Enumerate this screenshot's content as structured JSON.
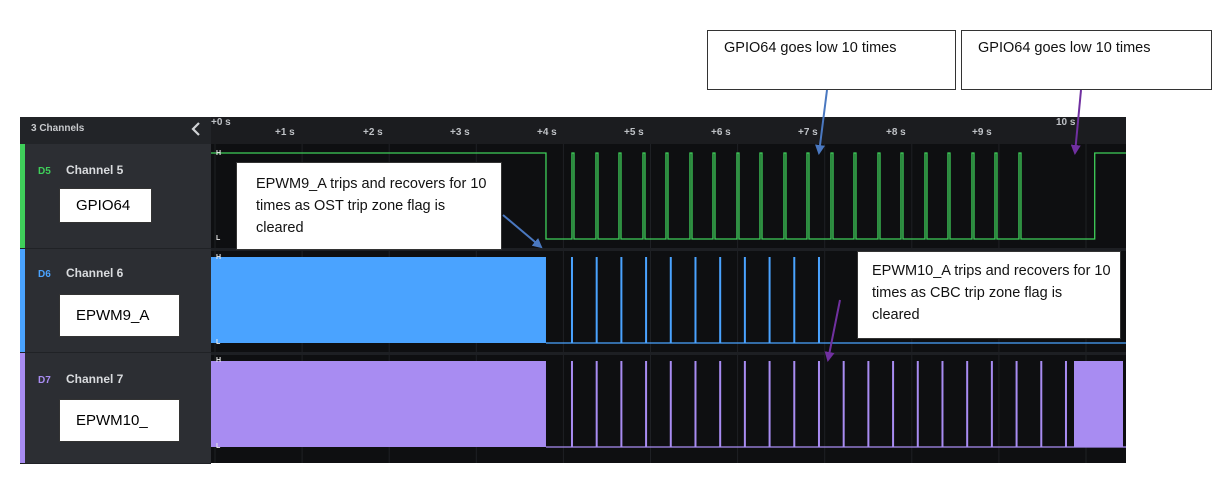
{
  "sidebar": {
    "header_title": "3 Channels",
    "channels": [
      {
        "id": "D5",
        "name": "Channel 5",
        "label": "GPIO64",
        "color": "#3fcf5a"
      },
      {
        "id": "D6",
        "name": "Channel 6",
        "label": "EPWM9_A",
        "color": "#4aa3ff"
      },
      {
        "id": "D7",
        "name": "Channel 7",
        "label": "EPWM10_",
        "color": "#a88cf2"
      }
    ]
  },
  "ruler": {
    "ticks": [
      "+0 s",
      "+1 s",
      "+2 s",
      "+3 s",
      "+4 s",
      "+5 s",
      "+6 s",
      "+7 s",
      "+8 s",
      "+9 s",
      "10 s"
    ]
  },
  "level_labels": {
    "high": "H",
    "low": "L"
  },
  "waveforms": {
    "gpio64": {
      "low_pulse_count": 10,
      "pattern_start_s": 3.8,
      "pattern_end_s": 10.1
    },
    "epwm9a": {
      "trip_recover_count": 10,
      "pattern_start_s": 3.8
    },
    "epwm10a": {
      "trip_recover_count": 10,
      "pattern_start_s": 3.8
    }
  },
  "annotations": {
    "note_gpio_1": "GPIO64 goes low 10 times",
    "note_gpio_2": "GPIO64 goes low 10 times",
    "note_epwm9": "EPWM9_A trips and recovers for 10 times as OST trip zone flag is cleared",
    "note_epwm10": "EPWM10_A trips and recovers for 10 times as CBC trip zone flag is cleared",
    "arrow_blue_color": "#4a78c0",
    "arrow_purple_color": "#7030a0"
  }
}
